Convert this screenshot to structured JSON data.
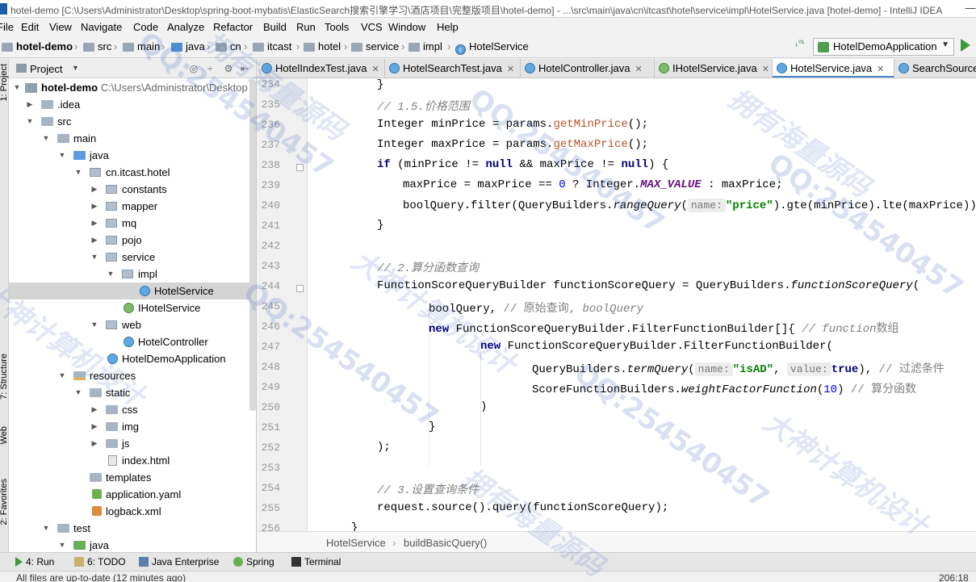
{
  "window": {
    "title": "hotel-demo [C:\\Users\\Administrator\\Desktop\\spring-boot-mybatis\\ElasticSearch搜索引擎学习\\酒店项目\\完整版项目\\hotel-demo] - ...\\src\\main\\java\\cn\\itcast\\hotel\\service\\impl\\HotelService.java [hotel-demo] - IntelliJ IDEA"
  },
  "menu": [
    "File",
    "Edit",
    "View",
    "Navigate",
    "Code",
    "Analyze",
    "Refactor",
    "Build",
    "Run",
    "Tools",
    "VCS",
    "Window",
    "Help"
  ],
  "breadcrumbs": [
    "hotel-demo",
    "src",
    "main",
    "java",
    "cn",
    "itcast",
    "hotel",
    "service",
    "impl",
    "HotelService"
  ],
  "run_config": "HotelDemoApplication",
  "left_strip": {
    "project_tab": "1: Project",
    "structure_tab": "7: Structure",
    "web_tab": "Web",
    "favorites_tab": "2: Favorites"
  },
  "project_panel": {
    "title": "Project",
    "tree": [
      {
        "label": "hotel-demo",
        "suffix": "C:\\Users\\Administrator\\Desktop"
      },
      {
        "label": ".idea"
      },
      {
        "label": "src"
      },
      {
        "label": "main"
      },
      {
        "label": "java"
      },
      {
        "label": "cn.itcast.hotel"
      },
      {
        "label": "constants"
      },
      {
        "label": "mapper"
      },
      {
        "label": "mq"
      },
      {
        "label": "pojo"
      },
      {
        "label": "service"
      },
      {
        "label": "impl"
      },
      {
        "label": "HotelService"
      },
      {
        "label": "IHotelService"
      },
      {
        "label": "web"
      },
      {
        "label": "HotelController"
      },
      {
        "label": "HotelDemoApplication"
      },
      {
        "label": "resources"
      },
      {
        "label": "static"
      },
      {
        "label": "css"
      },
      {
        "label": "img"
      },
      {
        "label": "js"
      },
      {
        "label": "index.html"
      },
      {
        "label": "templates"
      },
      {
        "label": "application.yaml"
      },
      {
        "label": "logback.xml"
      },
      {
        "label": "test"
      },
      {
        "label": "java"
      }
    ]
  },
  "tabs": [
    "HotelIndexTest.java",
    "HotelSearchTest.java",
    "HotelController.java",
    "IHotelService.java",
    "HotelService.java",
    "SearchSource"
  ],
  "active_tab": "HotelService.java",
  "code": {
    "line_numbers": [
      "234",
      "235",
      "236",
      "237",
      "238",
      "239",
      "240",
      "241",
      "242",
      "243",
      "244",
      "245",
      "246",
      "247",
      "248",
      "249",
      "250",
      "251",
      "252",
      "253",
      "254",
      "255",
      "256"
    ],
    "l234": "}",
    "l235_comment": "// 1.5.价格范围",
    "l236_a": "Integer minPrice = params.",
    "l236_m": "getMinPrice",
    "l236_b": "();",
    "l237_a": "Integer maxPrice = params.",
    "l237_m": "getMaxPrice",
    "l237_b": "();",
    "l238_kw1": "if",
    "l238_a": " (minPrice != ",
    "l238_kw2": "null",
    "l238_b": " && maxPrice != ",
    "l238_kw3": "null",
    "l238_c": ") {",
    "l239_a": "maxPrice = maxPrice == ",
    "l239_num": "0",
    "l239_b": " ? Integer.",
    "l239_const": "MAX_VALUE",
    "l239_c": " : maxPrice;",
    "l240_a": "boolQuery.filter(QueryBuilders.",
    "l240_m": "rangeQuery",
    "l240_b": "(",
    "l240_hint": "name:",
    "l240_str": "\"price\"",
    "l240_c": ").gte(minPrice).lte(maxPrice));",
    "l241": "}",
    "l243_comment": "// 2.算分函数查询",
    "l244_a": "FunctionScoreQueryBuilder functionScoreQuery = QueryBuilders.",
    "l244_m": "functionScoreQuery",
    "l244_b": "(",
    "l245_a": "boolQuery, ",
    "l245_comment": "// 原始查询, ",
    "l245_ci": "boolQuery",
    "l246_kw": "new",
    "l246_a": " FunctionScoreQueryBuilder.FilterFunctionBuilder[]{ ",
    "l246_comment": "// function",
    "l246_cn": "数组",
    "l247_kw": "new",
    "l247_a": " FunctionScoreQueryBuilder.FilterFunctionBuilder(",
    "l248_a": "QueryBuilders.",
    "l248_m": "termQuery",
    "l248_b": "(",
    "l248_hint1": "name:",
    "l248_str": "\"isAD\"",
    "l248_c": ", ",
    "l248_hint2": "value:",
    "l248_kw": "true",
    "l248_d": "), ",
    "l248_comment": "// 过滤条件",
    "l249_a": "ScoreFunctionBuilders.",
    "l249_m": "weightFactorFunction",
    "l249_b": "(",
    "l249_num": "10",
    "l249_c": ") ",
    "l249_comment": "// 算分函数",
    "l250": ")",
    "l251": "}",
    "l252": ");",
    "l254_comment": "// 3.设置查询条件",
    "l255": "request.source().query(functionScoreQuery);",
    "l256": "}"
  },
  "editor_crumbs": [
    "HotelService",
    "buildBasicQuery()"
  ],
  "bottom_tools": [
    "4: Run",
    "6: TODO",
    "Java Enterprise",
    "Spring",
    "Terminal"
  ],
  "status": {
    "message": "All files are up-to-date (12 minutes ago)",
    "position": "206:18"
  },
  "watermarks": [
    "QQ:254540457",
    "大神计算机设计",
    "拥有海量源码"
  ]
}
